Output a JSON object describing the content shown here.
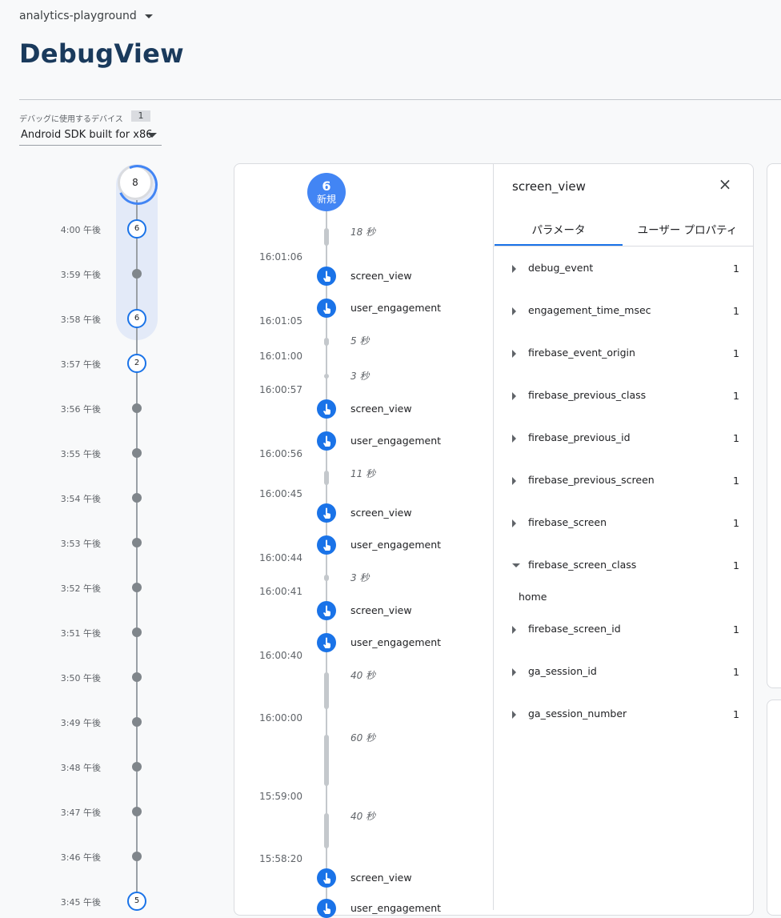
{
  "header": {
    "project": "analytics-playground",
    "title": "DebugView"
  },
  "device": {
    "label": "デバッグに使用するデバイス",
    "count": "1",
    "selected": "Android SDK built for x86"
  },
  "minutes": {
    "top_count": "8",
    "rows": [
      {
        "label": "4:00 午後",
        "count": "6"
      },
      {
        "label": "3:59 午後",
        "count": ""
      },
      {
        "label": "3:58 午後",
        "count": "6"
      },
      {
        "label": "3:57 午後",
        "count": "2"
      },
      {
        "label": "3:56 午後",
        "count": ""
      },
      {
        "label": "3:55 午後",
        "count": ""
      },
      {
        "label": "3:54 午後",
        "count": ""
      },
      {
        "label": "3:53 午後",
        "count": ""
      },
      {
        "label": "3:52 午後",
        "count": ""
      },
      {
        "label": "3:51 午後",
        "count": ""
      },
      {
        "label": "3:50 午後",
        "count": ""
      },
      {
        "label": "3:49 午後",
        "count": ""
      },
      {
        "label": "3:48 午後",
        "count": ""
      },
      {
        "label": "3:47 午後",
        "count": ""
      },
      {
        "label": "3:46 午後",
        "count": ""
      },
      {
        "label": "3:45 午後",
        "count": "5"
      }
    ]
  },
  "events": {
    "new_count": "6",
    "new_label": "新規",
    "gaps": [
      "18 秒",
      "5 秒",
      "3 秒",
      "11 秒",
      "3 秒",
      "40 秒",
      "60 秒",
      "40 秒"
    ],
    "timestamps": [
      "16:01:06",
      "16:01:05",
      "16:01:00",
      "16:00:57",
      "16:00:56",
      "16:00:45",
      "16:00:44",
      "16:00:41",
      "16:00:40",
      "16:00:00",
      "15:59:00",
      "15:58:20"
    ],
    "items": [
      "screen_view",
      "user_engagement",
      "screen_view",
      "user_engagement",
      "screen_view",
      "user_engagement",
      "screen_view",
      "user_engagement",
      "screen_view",
      "user_engagement"
    ]
  },
  "details": {
    "title": "screen_view",
    "close_icon": "close-icon",
    "tabs": [
      "パラメータ",
      "ユーザー プロパティ"
    ],
    "params": [
      {
        "name": "debug_event",
        "count": "1"
      },
      {
        "name": "engagement_time_msec",
        "count": "1"
      },
      {
        "name": "firebase_event_origin",
        "count": "1"
      },
      {
        "name": "firebase_previous_class",
        "count": "1"
      },
      {
        "name": "firebase_previous_id",
        "count": "1"
      },
      {
        "name": "firebase_previous_screen",
        "count": "1"
      },
      {
        "name": "firebase_screen",
        "count": "1"
      },
      {
        "name": "firebase_screen_class",
        "count": "1"
      },
      {
        "name": "firebase_screen_id",
        "count": "1"
      },
      {
        "name": "ga_session_id",
        "count": "1"
      },
      {
        "name": "ga_session_number",
        "count": "1"
      }
    ],
    "expanded_value": "home"
  },
  "colors": {
    "accent": "#1a73e8",
    "badge": "#4285f4",
    "title": "#1a3a5c"
  }
}
